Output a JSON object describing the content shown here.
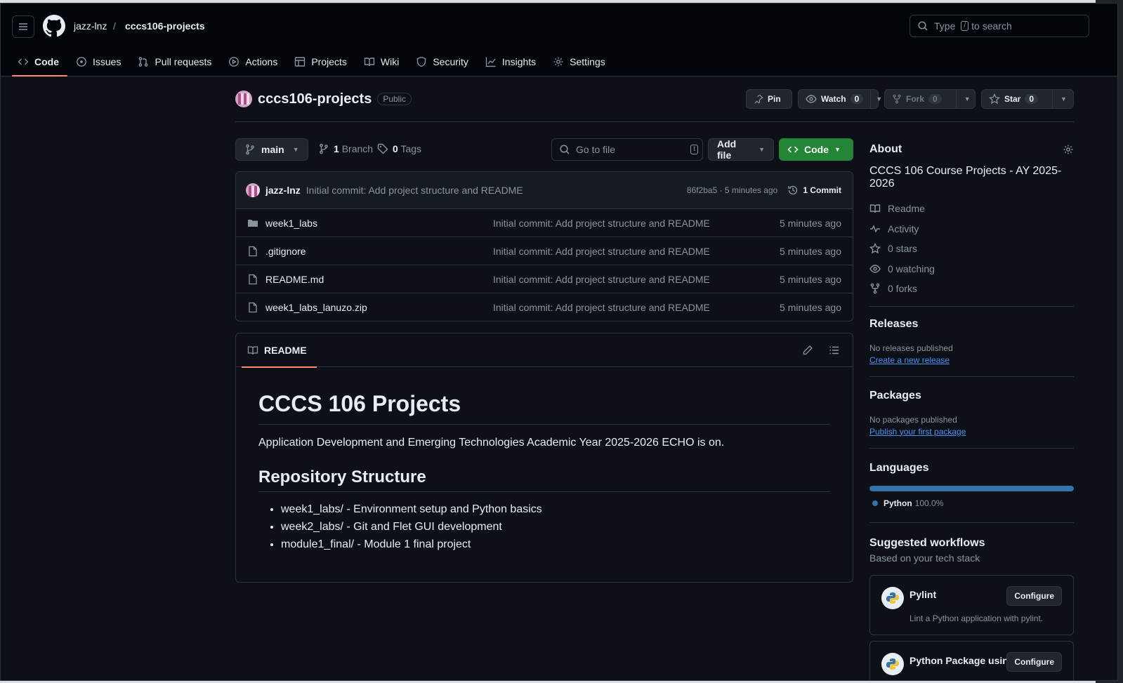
{
  "header": {
    "owner": "jazz-lnz",
    "separator": "/",
    "repo": "cccs106-projects",
    "search_pre": "Type",
    "search_key": "/",
    "search_post": "to search"
  },
  "tabs": [
    {
      "label": "Code",
      "icon": "code-icon"
    },
    {
      "label": "Issues",
      "icon": "issue-icon"
    },
    {
      "label": "Pull requests",
      "icon": "pull-request-icon"
    },
    {
      "label": "Actions",
      "icon": "play-icon"
    },
    {
      "label": "Projects",
      "icon": "table-icon"
    },
    {
      "label": "Wiki",
      "icon": "book-icon"
    },
    {
      "label": "Security",
      "icon": "shield-icon"
    },
    {
      "label": "Insights",
      "icon": "graph-icon"
    },
    {
      "label": "Settings",
      "icon": "gear-icon"
    }
  ],
  "repo_head": {
    "name": "cccs106-projects",
    "visibility": "Public",
    "pin": "Pin",
    "watch": "Watch",
    "watch_count": "0",
    "fork": "Fork",
    "fork_count": "0",
    "star": "Star",
    "star_count": "0"
  },
  "toolbar": {
    "branch": "main",
    "branch_count": "1",
    "branch_label": "Branch",
    "tags_count": "0",
    "tags_label": "Tags",
    "goto_placeholder": "Go to file",
    "goto_key": "t",
    "add_file": "Add file",
    "code": "Code"
  },
  "latest_commit": {
    "author": "jazz-lnz",
    "message": "Initial commit: Add project structure and README",
    "meta": "86f2ba5 · 5 minutes ago",
    "commits": "1 Commit"
  },
  "files": [
    {
      "name": "week1_labs",
      "type": "folder",
      "message": "Initial commit: Add project structure and README",
      "age": "5 minutes ago"
    },
    {
      "name": ".gitignore",
      "type": "file",
      "message": "Initial commit: Add project structure and README",
      "age": "5 minutes ago"
    },
    {
      "name": "README.md",
      "type": "file",
      "message": "Initial commit: Add project structure and README",
      "age": "5 minutes ago"
    },
    {
      "name": "week1_labs_lanuzo.zip",
      "type": "file",
      "message": "Initial commit: Add project structure and README",
      "age": "5 minutes ago"
    }
  ],
  "readme": {
    "tab": "README",
    "h1": "CCCS 106 Projects",
    "p": "Application Development and Emerging Technologies Academic Year 2025-2026 ECHO is on.",
    "h2": "Repository Structure",
    "items": [
      "week1_labs/ - Environment setup and Python basics",
      "week2_labs/ - Git and Flet GUI development",
      "module1_final/ - Module 1 final project"
    ]
  },
  "about": {
    "title": "About",
    "description": "CCCS 106 Course Projects - AY 2025-2026",
    "links": [
      {
        "label": "Readme",
        "icon": "book-icon"
      },
      {
        "label": "Activity",
        "icon": "pulse-icon"
      },
      {
        "label": "0 stars",
        "icon": "star-icon"
      },
      {
        "label": "0 watching",
        "icon": "eye-icon"
      },
      {
        "label": "0 forks",
        "icon": "fork-icon"
      }
    ]
  },
  "releases": {
    "title": "Releases",
    "empty": "No releases published",
    "link": "Create a new release"
  },
  "packages": {
    "title": "Packages",
    "empty": "No packages published",
    "link": "Publish your first package"
  },
  "languages": {
    "title": "Languages",
    "name": "Python",
    "percent": "100.0%",
    "share": 100,
    "color": "#3572A5"
  },
  "workflows": {
    "title": "Suggested workflows",
    "subtitle": "Based on your tech stack",
    "items": [
      {
        "name": "Pylint",
        "desc": "Lint a Python application with pylint.",
        "button": "Configure"
      },
      {
        "name": "Python Package using",
        "desc": "",
        "button": "Configure"
      }
    ]
  },
  "colors": {
    "accent": "#fd8c73",
    "code_button": "#238636",
    "link": "#4493f8",
    "background": "#0d1117"
  }
}
